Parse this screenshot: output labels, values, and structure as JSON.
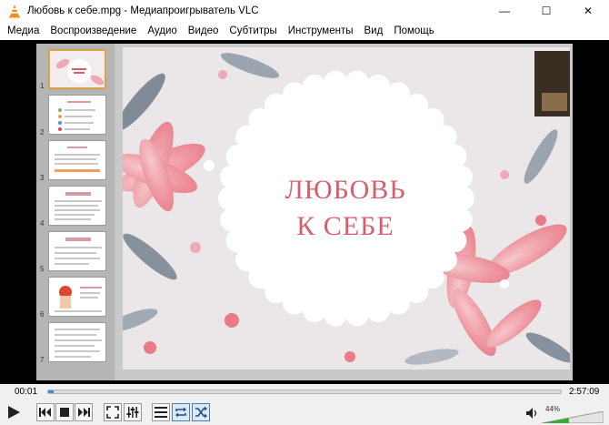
{
  "window": {
    "title": "Любовь к себе.mpg - Медиапроигрыватель VLC",
    "minimize_glyph": "—",
    "maximize_glyph": "☐",
    "close_glyph": "✕"
  },
  "menu": {
    "items": [
      {
        "label": "Медиа"
      },
      {
        "label": "Воспроизведение"
      },
      {
        "label": "Аудио"
      },
      {
        "label": "Видео"
      },
      {
        "label": "Субтитры"
      },
      {
        "label": "Инструменты"
      },
      {
        "label": "Вид"
      },
      {
        "label": "Помощь"
      }
    ]
  },
  "video": {
    "slide_title_line1": "ЛЮБОВЬ",
    "slide_title_line2": "К СЕБЕ",
    "thumbnails": [
      {
        "number": "1"
      },
      {
        "number": "2"
      },
      {
        "number": "3"
      },
      {
        "number": "4"
      },
      {
        "number": "5"
      },
      {
        "number": "6"
      },
      {
        "number": "7"
      }
    ],
    "accent_color": "#d45f6d"
  },
  "playback": {
    "elapsed": "00:01",
    "duration": "2:57:09",
    "progress": 0.01
  },
  "volume": {
    "level_text": "44%",
    "level": 0.44
  },
  "icons": {
    "play": "play-icon",
    "previous": "previous-icon",
    "stop": "stop-icon",
    "next": "next-icon",
    "fullscreen": "fullscreen-icon",
    "extended": "extended-settings-icon",
    "playlist": "playlist-icon",
    "loop": "loop-icon",
    "random": "shuffle-icon",
    "speaker": "speaker-icon"
  }
}
